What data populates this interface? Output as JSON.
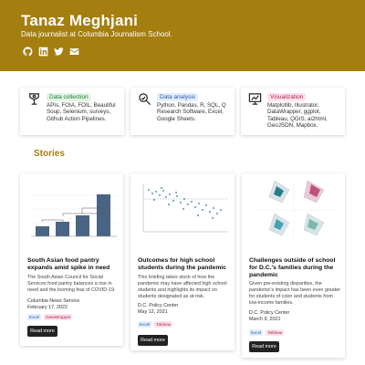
{
  "profile": {
    "name": "Tanaz Meghjani",
    "subtitle": "Data journalist at Columbia Journalism School.",
    "social_icons": [
      "github-icon",
      "linkedin-icon",
      "twitter-icon",
      "email-icon"
    ]
  },
  "skills": [
    {
      "icon": "data-collection-icon",
      "label": "Data collection",
      "desc": "APIs, FOIA, FOIL, Beautiful Soup, Selenium, surveys, Github Action Pipelines."
    },
    {
      "icon": "data-analysis-icon",
      "label": "Data analysis",
      "desc": "Python, Pandas, R, SQL, Q Research Software, Excel, Google Sheets."
    },
    {
      "icon": "visualization-icon",
      "label": "Visualization",
      "desc": "Matplotlib, Illustrator, DataWrapper, ggplot, Tableau, QGIS, ai2html, GeoJSON, Mapbox."
    }
  ],
  "stories_title": "Stories",
  "stories": [
    {
      "title": "South Asian food pantry expands amid spike in need",
      "summary": "The South Asian Council for Social Services food pantry balances a rise in need and the looming fear of COVID-19.",
      "source": "Columbia News Service",
      "date": "February 17, 2022",
      "tags": [
        "Excel",
        "DataWrapper"
      ],
      "button": "Read more"
    },
    {
      "title": "Outcomes for high school students during the pandemic",
      "summary": "This briefing takes stock of how the pandemic may have affected high school students and highlights its impact on students designated as at-risk.",
      "source": "D.C. Policy Center",
      "date": "May 12, 2021",
      "tags": [
        "Excel",
        "Tableau"
      ],
      "button": "Read more"
    },
    {
      "title": "Challenges outside of school for D.C.'s families during the pandemic",
      "summary": "Given pre-existing disparities, the pandemic's impact has been even greater for students of color and students from low-income families.",
      "source": "D.C. Policy Center",
      "date": "March 9, 2021",
      "tags": [
        "Excel",
        "Tableau"
      ],
      "button": "Read more"
    }
  ],
  "colors": {
    "brand": "#a57e10",
    "bar": "#4a6584",
    "teal": "#2a7b88",
    "pink": "#c0507e"
  }
}
